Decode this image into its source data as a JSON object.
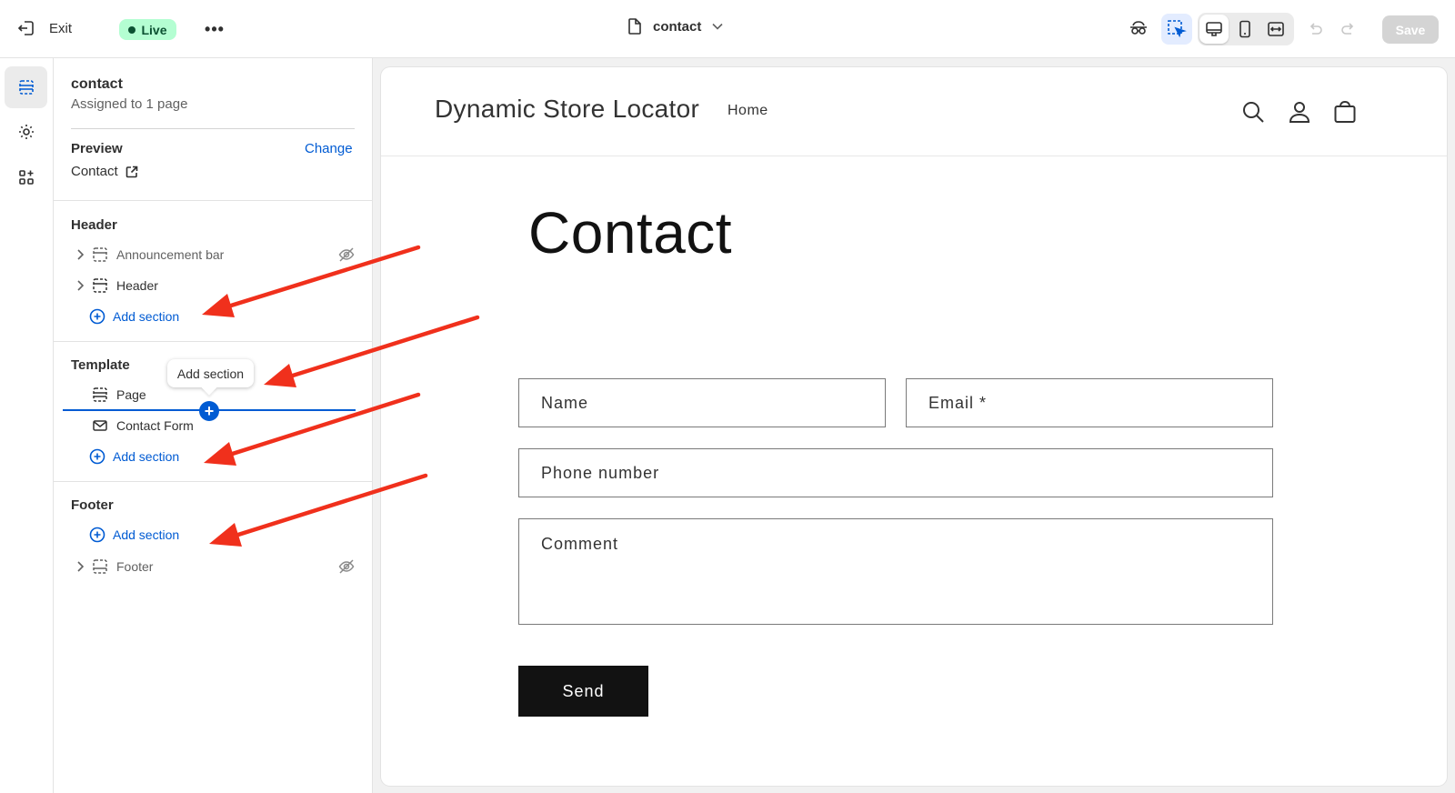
{
  "topbar": {
    "exit_label": "Exit",
    "status_label": "Live",
    "more_label": "•••",
    "page_name": "contact",
    "save_label": "Save"
  },
  "sidebar": {
    "template_name": "contact",
    "assigned": "Assigned to 1 page",
    "preview_label": "Preview",
    "change_label": "Change",
    "preview_value": "Contact",
    "groups": {
      "header": {
        "label": "Header",
        "items": [
          {
            "label": "Announcement bar",
            "hidden": true
          },
          {
            "label": "Header",
            "hidden": false
          }
        ],
        "add_label": "Add section"
      },
      "template": {
        "label": "Template",
        "items": [
          {
            "label": "Page"
          },
          {
            "label": "Contact Form"
          }
        ],
        "add_label": "Add section"
      },
      "footer": {
        "label": "Footer",
        "add_label": "Add section",
        "items": [
          {
            "label": "Footer",
            "hidden": true
          }
        ]
      }
    },
    "tooltip": "Add section"
  },
  "store": {
    "name": "Dynamic Store Locator",
    "nav_home": "Home",
    "heading": "Contact",
    "fields": {
      "name": "Name",
      "email": "Email *",
      "phone": "Phone number",
      "comment": "Comment"
    },
    "send_label": "Send"
  },
  "colors": {
    "accent": "#005bd3",
    "live_bg": "#b4fed2",
    "annotation_arrow": "#f0301c"
  }
}
